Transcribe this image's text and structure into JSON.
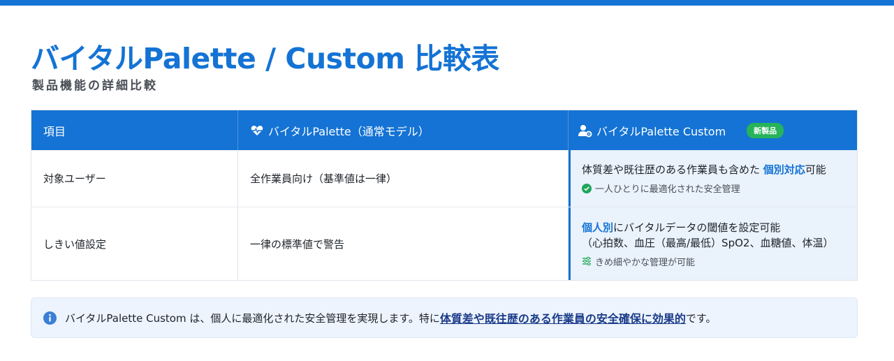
{
  "header": {
    "title": "バイタルPalette / Custom 比較表",
    "subtitle": "製品機能の詳細比較"
  },
  "table": {
    "columns": {
      "item": "項目",
      "standard": "バイタルPalette（通常モデル）",
      "custom": "バイタルPalette Custom",
      "badge": "新製品"
    },
    "rows": [
      {
        "label": "対象ユーザー",
        "standard": "全作業員向け（基準値は一律）",
        "custom_pre": "体質差や既往歴のある作業員も含めた ",
        "custom_hl": "個別対応",
        "custom_post": "可能",
        "custom_sub": "一人ひとりに最適化された安全管理"
      },
      {
        "label": "しきい値設定",
        "standard": "一律の標準値で警告",
        "custom_hl": "個人別",
        "custom_post": "にバイタルデータの閾値を設定可能",
        "custom_line2": "（心拍数、血圧（最高/最低）SpO2、血糖値、体温）",
        "custom_sub": "きめ細やかな管理が可能"
      }
    ]
  },
  "note": {
    "text_pre": "バイタルPalette Custom は、個人に最適化された安全管理を実現します。特に",
    "text_hl": "体質差や既往歴のある作業員の安全確保に効果的",
    "text_post": "です。"
  },
  "colors": {
    "accent": "#1473d4",
    "badge": "#26b35a",
    "check": "#1fa65a",
    "highlight_panel": "#eaf2fc"
  },
  "icons": {
    "standard_header": "heartbeat-icon",
    "custom_header": "user-gear-icon",
    "row1_sub": "check-circle-icon",
    "row2_sub": "sliders-icon",
    "note": "info-icon"
  }
}
